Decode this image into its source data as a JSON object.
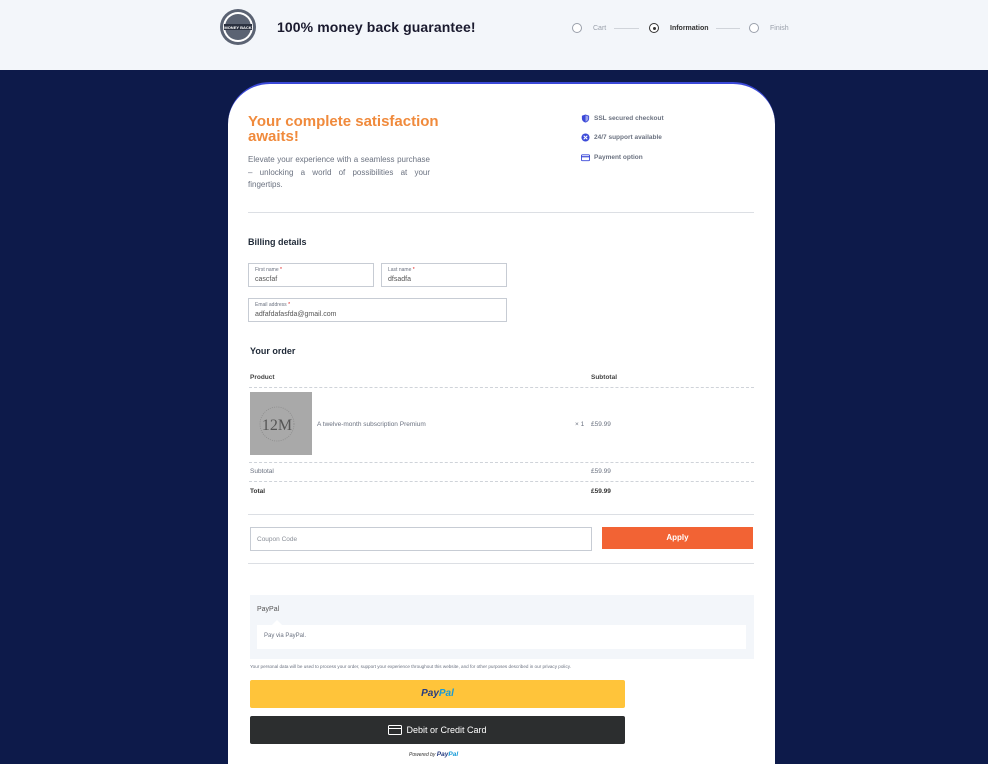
{
  "header": {
    "badge_text": "MONEY BACK",
    "guarantee": "100% money back guarantee!",
    "steps": [
      {
        "label": "Cart"
      },
      {
        "label": "Information"
      },
      {
        "label": "Finish"
      }
    ],
    "active_step": "Information"
  },
  "hero": {
    "headline": "Your complete satisfaction awaits!",
    "subcopy": "Elevate your experience with a seamless purchase – unlocking a world of possibilities at your fingertips."
  },
  "features": [
    {
      "icon": "shield-icon",
      "label": "SSL secured checkout"
    },
    {
      "icon": "support-icon",
      "label": "24/7 support available"
    },
    {
      "icon": "card-icon",
      "label": "Payment option"
    }
  ],
  "billing": {
    "title": "Billing details",
    "first_name": {
      "label": "First name",
      "value": "cascfaf"
    },
    "last_name": {
      "label": "Last name",
      "value": "dfsadfa"
    },
    "email": {
      "label": "Email address",
      "value": "adfafdafasfda@gmail.com"
    },
    "required_mark": "*"
  },
  "order": {
    "title": "Your order",
    "col_product": "Product",
    "col_subtotal": "Subtotal",
    "item": {
      "thumb_text": "12M",
      "name": "A twelve-month subscription Premium",
      "qty": "× 1",
      "price": "£59.99"
    },
    "subtotal_label": "Subtotal",
    "subtotal_value": "£59.99",
    "total_label": "Total",
    "total_value": "£59.99"
  },
  "coupon": {
    "placeholder": "Coupon Code",
    "apply_label": "Apply"
  },
  "payment": {
    "method": "PayPal",
    "description": "Pay via PayPal.",
    "privacy": "Your personal data will be used to process your order, support your experience throughout this website, and for other purposes described in our privacy policy.",
    "paypal_part1": "Pay",
    "paypal_part2": "Pal",
    "card_label": "Debit or Credit Card",
    "powered_prefix": "Powered by",
    "powered_brand1": "Pay",
    "powered_brand2": "Pal"
  },
  "colors": {
    "background": "#0d1a4a",
    "accent_orange": "#f08a3c",
    "apply_button": "#f26334",
    "paypal_yellow": "#ffc43a",
    "card_button": "#2c2e2f",
    "card_border": "#3b49d8"
  }
}
